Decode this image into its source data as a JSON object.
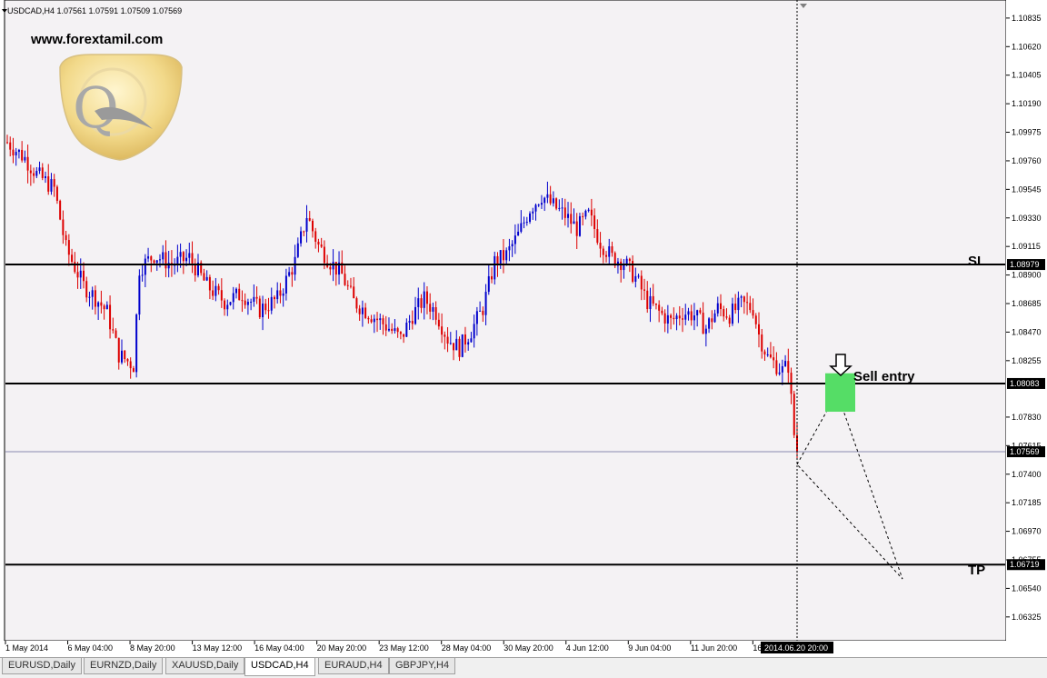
{
  "header": {
    "symbol_line": "USDCAD,H4  1.07561 1.07591 1.07509 1.07569"
  },
  "branding": {
    "website": "www.forextamil.com",
    "logo_letter": "Q"
  },
  "colors": {
    "bull": "#0000cc",
    "bear": "#dd0000",
    "level_line": "#000000",
    "entry_zone": "#55dd66",
    "background": "#f4f2f4",
    "price_line": "#8a8ab0"
  },
  "annotations": {
    "sl_label": "SL",
    "tp_label": "TP",
    "entry_label": "Sell entry",
    "entry_arrow": "down-arrow-icon"
  },
  "chart_data": {
    "type": "candlestick",
    "symbol": "USDCAD",
    "timeframe": "H4",
    "ohlc_last": {
      "open": 1.07561,
      "high": 1.07591,
      "low": 1.07509,
      "close": 1.07569
    },
    "ylim": [
      1.0618,
      1.1093
    ],
    "y_ticks": [
      "1.10835",
      "1.10620",
      "1.10405",
      "1.10190",
      "1.09975",
      "1.09760",
      "1.09545",
      "1.09330",
      "1.09115",
      "1.08900",
      "1.08685",
      "1.08470",
      "1.08255",
      "1.07830",
      "1.07615",
      "1.07400",
      "1.07185",
      "1.06970",
      "1.06755",
      "1.06540",
      "1.06325"
    ],
    "x_ticks": [
      "1 May 2014",
      "6 May 04:00",
      "8 May 20:00",
      "13 May 12:00",
      "16 May 04:00",
      "20 May 20:00",
      "23 May 12:00",
      "28 May 04:00",
      "30 May 20:00",
      "4 Jun 12:00",
      "9 Jun 04:00",
      "11 Jun 20:00",
      "16 Jun 12:00"
    ],
    "crosshair_time": "2014.06.20 20:00",
    "levels": [
      {
        "name": "SL",
        "price": 1.08979,
        "label": "1.08979"
      },
      {
        "name": "Sell entry",
        "price": 1.08083,
        "label": "1.08083"
      },
      {
        "name": "TP",
        "price": 1.06719,
        "label": "1.06719"
      }
    ],
    "current_price": {
      "price": 1.07569,
      "label": "1.07569"
    },
    "entry_zone": {
      "price_top": 1.0816,
      "price_bottom": 1.0798
    },
    "price_path": [
      {
        "x": 0,
        "y": 1.099
      },
      {
        "x": 6,
        "y": 1.0978
      },
      {
        "x": 10,
        "y": 1.0966
      },
      {
        "x": 16,
        "y": 1.0955
      },
      {
        "x": 20,
        "y": 1.091
      },
      {
        "x": 26,
        "y": 1.0882
      },
      {
        "x": 30,
        "y": 1.0873
      },
      {
        "x": 34,
        "y": 1.0862
      },
      {
        "x": 38,
        "y": 1.083
      },
      {
        "x": 43,
        "y": 1.0822
      },
      {
        "x": 45,
        "y": 1.0895
      },
      {
        "x": 50,
        "y": 1.0905
      },
      {
        "x": 56,
        "y": 1.0898
      },
      {
        "x": 62,
        "y": 1.0903
      },
      {
        "x": 68,
        "y": 1.0882
      },
      {
        "x": 74,
        "y": 1.087
      },
      {
        "x": 80,
        "y": 1.0876
      },
      {
        "x": 86,
        "y": 1.0864
      },
      {
        "x": 92,
        "y": 1.0872
      },
      {
        "x": 98,
        "y": 1.09
      },
      {
        "x": 102,
        "y": 1.0935
      },
      {
        "x": 106,
        "y": 1.0912
      },
      {
        "x": 110,
        "y": 1.09
      },
      {
        "x": 114,
        "y": 1.089
      },
      {
        "x": 118,
        "y": 1.087
      },
      {
        "x": 124,
        "y": 1.086
      },
      {
        "x": 130,
        "y": 1.085
      },
      {
        "x": 134,
        "y": 1.0842
      },
      {
        "x": 138,
        "y": 1.086
      },
      {
        "x": 142,
        "y": 1.0872
      },
      {
        "x": 146,
        "y": 1.0862
      },
      {
        "x": 150,
        "y": 1.0842
      },
      {
        "x": 154,
        "y": 1.0835
      },
      {
        "x": 158,
        "y": 1.0848
      },
      {
        "x": 162,
        "y": 1.0865
      },
      {
        "x": 166,
        "y": 1.09
      },
      {
        "x": 170,
        "y": 1.0905
      },
      {
        "x": 174,
        "y": 1.092
      },
      {
        "x": 178,
        "y": 1.094
      },
      {
        "x": 182,
        "y": 1.095
      },
      {
        "x": 186,
        "y": 1.0942
      },
      {
        "x": 190,
        "y": 1.0935
      },
      {
        "x": 194,
        "y": 1.0925
      },
      {
        "x": 198,
        "y": 1.0935
      },
      {
        "x": 202,
        "y": 1.0915
      },
      {
        "x": 206,
        "y": 1.0903
      },
      {
        "x": 210,
        "y": 1.09
      },
      {
        "x": 214,
        "y": 1.0888
      },
      {
        "x": 218,
        "y": 1.087
      },
      {
        "x": 222,
        "y": 1.0862
      },
      {
        "x": 226,
        "y": 1.0855
      },
      {
        "x": 230,
        "y": 1.0862
      },
      {
        "x": 234,
        "y": 1.086
      },
      {
        "x": 238,
        "y": 1.085
      },
      {
        "x": 242,
        "y": 1.0865
      },
      {
        "x": 246,
        "y": 1.086
      },
      {
        "x": 250,
        "y": 1.0868
      },
      {
        "x": 254,
        "y": 1.0865
      },
      {
        "x": 256,
        "y": 1.0845
      },
      {
        "x": 259,
        "y": 1.0828
      },
      {
        "x": 262,
        "y": 1.0822
      },
      {
        "x": 264,
        "y": 1.0818
      },
      {
        "x": 266,
        "y": 1.0822
      },
      {
        "x": 268,
        "y": 1.077
      },
      {
        "x": 269,
        "y": 1.0757
      }
    ]
  },
  "tabs": [
    {
      "label": "EURUSD,Daily",
      "active": false
    },
    {
      "label": "EURNZD,Daily",
      "active": false
    },
    {
      "label": "XAUUSD,Daily",
      "active": false
    },
    {
      "label": "USDCAD,H4",
      "active": true
    },
    {
      "label": "EURAUD,H4",
      "active": false
    },
    {
      "label": "GBPJPY,H4",
      "active": false
    }
  ]
}
